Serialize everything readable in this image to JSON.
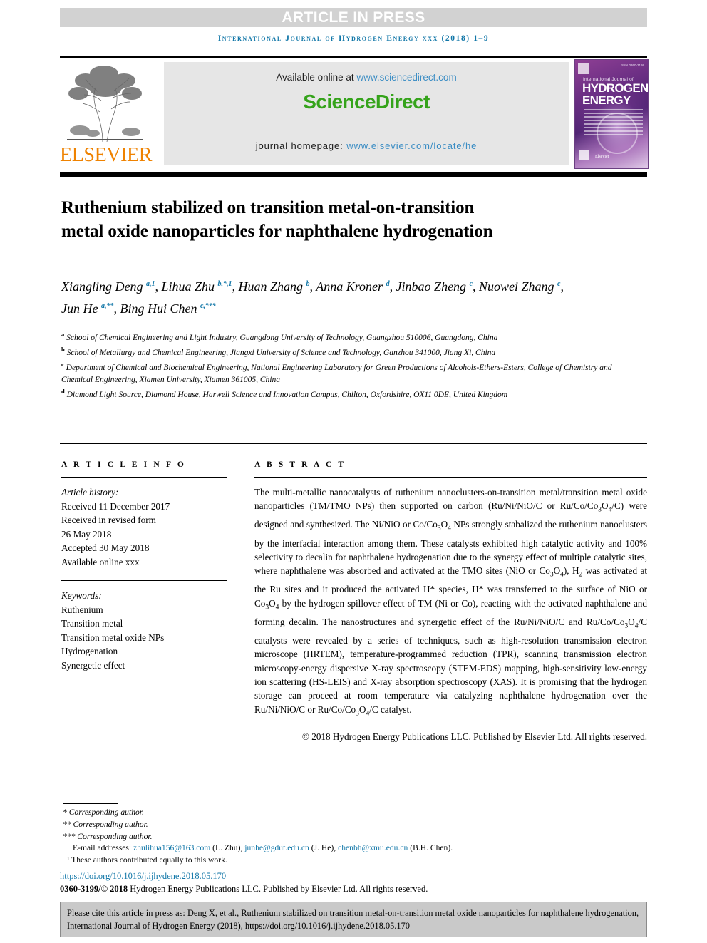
{
  "banner": {
    "label": "ARTICLE IN PRESS"
  },
  "running_head": "International Journal of Hydrogen Energy xxx (2018) 1–9",
  "masthead": {
    "available_prefix": "Available online at ",
    "available_link": "www.sciencedirect.com",
    "sciencedirect_logo": "ScienceDirect",
    "homepage_prefix": "journal homepage: ",
    "homepage_link": "www.elsevier.com/locate/he",
    "publisher_word": "ELSEVIER",
    "cover": {
      "line1": "International Journal of",
      "line2": "HYDROGEN",
      "line3": "ENERGY",
      "publisher": "Elsevier",
      "corner_code": "ISSN 0360-3199"
    }
  },
  "title": "Ruthenium stabilized on transition metal-on-transition metal oxide nanoparticles for naphthalene hydrogenation",
  "authors_html": "Xiangling Deng <sup>a,1</sup>, Lihua Zhu <sup>b,*,1</sup>, Huan Zhang <sup>b</sup>, Anna Kroner <sup>d</sup>, Jinbao Zheng <sup>c</sup>, Nuowei Zhang <sup>c</sup>, Jun He <sup>a,**</sup>, Bing Hui Chen <sup>c,***</sup>",
  "affiliations": [
    {
      "mark": "a",
      "text": "School of Chemical Engineering and Light Industry, Guangdong University of Technology, Guangzhou 510006, Guangdong, China"
    },
    {
      "mark": "b",
      "text": "School of Metallurgy and Chemical Engineering, Jiangxi University of Science and Technology, Ganzhou 341000, Jiang Xi, China"
    },
    {
      "mark": "c",
      "text": "Department of Chemical and Biochemical Engineering, National Engineering Laboratory for Green Productions of Alcohols-Ethers-Esters, College of Chemistry and Chemical Engineering, Xiamen University, Xiamen 361005, China"
    },
    {
      "mark": "d",
      "text": "Diamond Light Source, Diamond House, Harwell Science and Innovation Campus, Chilton, Oxfordshire, OX11 0DE, United Kingdom"
    }
  ],
  "article_info": {
    "heading": "A R T I C L E   I N F O",
    "history_label": "Article history:",
    "history": [
      "Received 11 December 2017",
      "Received in revised form",
      "26 May 2018",
      "Accepted 30 May 2018",
      "Available online xxx"
    ],
    "keywords_label": "Keywords:",
    "keywords": [
      "Ruthenium",
      "Transition metal",
      "Transition metal oxide NPs",
      "Hydrogenation",
      "Synergetic effect"
    ]
  },
  "abstract": {
    "heading": "A B S T R A C T",
    "body_html": "The multi-metallic nanocatalysts of ruthenium nanoclusters-on-transition metal/transition metal oxide nanoparticles (TM/TMO NPs) then supported on carbon (Ru/Ni/NiO/C or Ru/Co/Co<sub>3</sub>O<sub>4</sub>/C) were designed and synthesized. The Ni/NiO or Co/Co<sub>3</sub>O<sub>4</sub> NPs strongly stabalized the ruthenium nanoclusters by the interfacial interaction among them. These catalysts exhibited high catalytic activity and 100% selectivity to decalin for naphthalene hydrogenation due to the synergy effect of multiple catalytic sites, where naphthalene was absorbed and activated at the TMO sites (NiO or Co<sub>3</sub>O<sub>4</sub>), H<sub>2</sub> was activated at the Ru sites and it produced the activated H* species, H* was transferred to the surface of NiO or Co<sub>3</sub>O<sub>4</sub> by the hydrogen spillover effect of TM (Ni or Co), reacting with the activated naphthalene and forming decalin. The nanostructures and synergetic effect of the Ru/Ni/NiO/C and Ru/Co/Co<sub>3</sub>O<sub>4</sub>/C catalysts were revealed by a series of techniques, such as high-resolution transmission electron microscope (HRTEM), temperature-programmed reduction (TPR), scanning transmission electron microscopy-energy dispersive X-ray spectroscopy (STEM-EDS) mapping, high-sensitivity low-energy ion scattering (HS-LEIS) and X-ray absorption spectroscopy (XAS). It is promising that the hydrogen storage can proceed at room temperature via catalyzing naphthalene hydrogenation over the Ru/Ni/NiO/C or Ru/Co/Co<sub>3</sub>O<sub>4</sub>/C catalyst.",
    "copyright": "© 2018 Hydrogen Energy Publications LLC. Published by Elsevier Ltd. All rights reserved."
  },
  "footnotes": {
    "corresponding_1": "* Corresponding author.",
    "corresponding_2": "** Corresponding author.",
    "corresponding_3": "*** Corresponding author.",
    "email_label": "E-mail addresses:",
    "emails": [
      {
        "address": "zhulihua156@163.com",
        "who": "(L. Zhu),"
      },
      {
        "address": "junhe@gdut.edu.cn",
        "who": "(J. He),"
      },
      {
        "address": "chenbh@xmu.edu.cn",
        "who": "(B.H. Chen)."
      }
    ],
    "equal_contrib": "¹ These authors contributed equally to this work.",
    "doi": "https://doi.org/10.1016/j.ijhydene.2018.05.170",
    "issn_bold": "0360-3199/© 2018",
    "issn_rest": " Hydrogen Energy Publications LLC. Published by Elsevier Ltd. All rights reserved."
  },
  "citation_box": {
    "text": "Please cite this article in press as: Deng X, et al., Ruthenium stabilized on transition metal-on-transition metal oxide nanoparticles for naphthalene hydrogenation, International Journal of Hydrogen Energy (2018), https://doi.org/10.1016/j.ijhydene.2018.05.170"
  },
  "colors": {
    "accent_blue": "#1277a8",
    "link_blue": "#3b8dc4",
    "sciencedirect_green": "#35a31b",
    "elsevier_orange": "#ef8200",
    "banner_gray": "#d2d2d2",
    "box_gray": "#e6e6e6",
    "cite_gray": "#c9c9c9"
  }
}
